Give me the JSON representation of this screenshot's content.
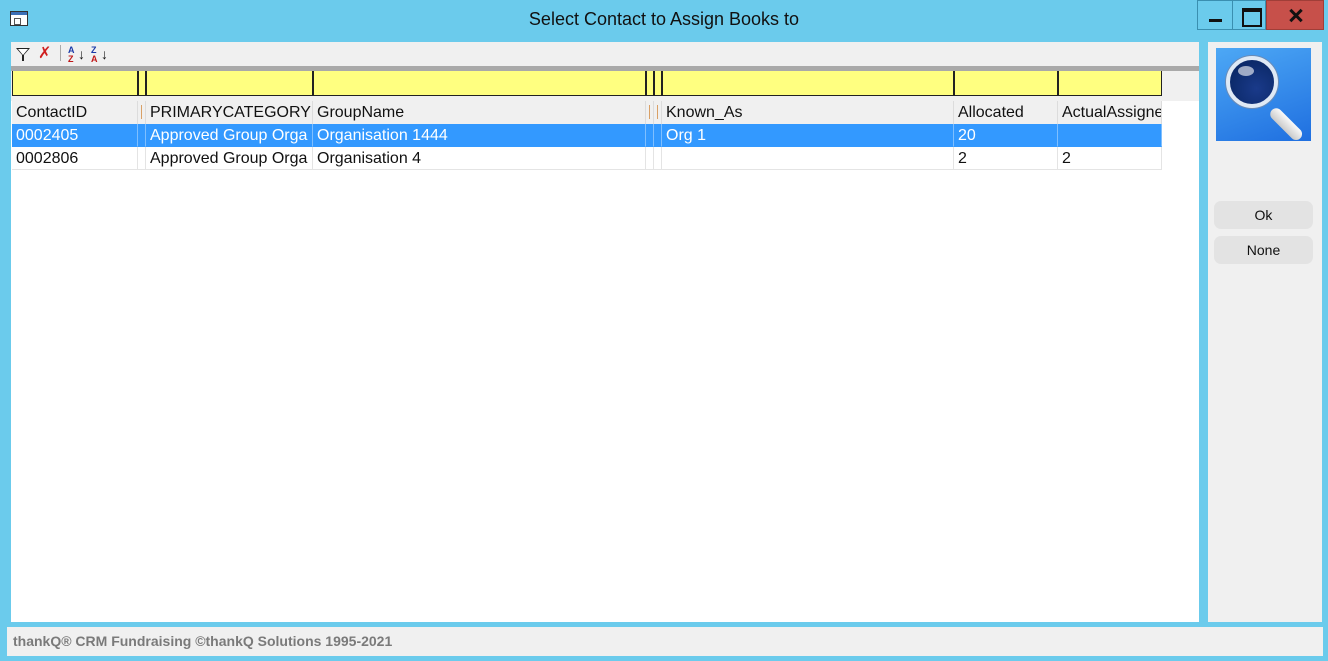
{
  "window": {
    "title": "Select Contact to Assign Books to",
    "icon": "app-window-icon",
    "controls": [
      "minimize-icon",
      "maximize-icon",
      "close-icon"
    ]
  },
  "toolbar": {
    "buttons": [
      {
        "name": "filter",
        "icon": "filter-icon"
      },
      {
        "name": "clear-filter",
        "icon": "clear-filter-icon"
      },
      {
        "name": "sort-ascending",
        "icon": "sort-az-icon",
        "label_top": "A",
        "label_bottom": "Z"
      },
      {
        "name": "sort-descending",
        "icon": "sort-za-icon",
        "label_top": "Z",
        "label_bottom": "A"
      }
    ]
  },
  "grid": {
    "columns": [
      {
        "key": "contactid",
        "label": "ContactID"
      },
      {
        "key": "primarycategory",
        "label": "PRIMARYCATEGORY"
      },
      {
        "key": "groupname",
        "label": "GroupName"
      },
      {
        "key": "known_as",
        "label": "Known_As"
      },
      {
        "key": "allocated",
        "label": "Allocated"
      },
      {
        "key": "actualassigned",
        "label": "ActualAssigne"
      }
    ],
    "rows": [
      {
        "contactid": "0002405",
        "primarycategory": "Approved Group Orga",
        "groupname": "Organisation 1444",
        "known_as": "Org 1",
        "allocated": "20",
        "actualassigned": "",
        "selected": true
      },
      {
        "contactid": "0002806",
        "primarycategory": "Approved Group Orga",
        "groupname": "Organisation 4",
        "known_as": "",
        "allocated": "2",
        "actualassigned": "2",
        "selected": false
      }
    ],
    "filter_row_color": "#ffff80",
    "selection_color": "#3399ff"
  },
  "side_panel": {
    "search_icon": "magnifier-icon",
    "ok_label": "Ok",
    "none_label": "None"
  },
  "status": {
    "text": "thankQ® CRM Fundraising ©thankQ Solutions 1995-2021"
  }
}
